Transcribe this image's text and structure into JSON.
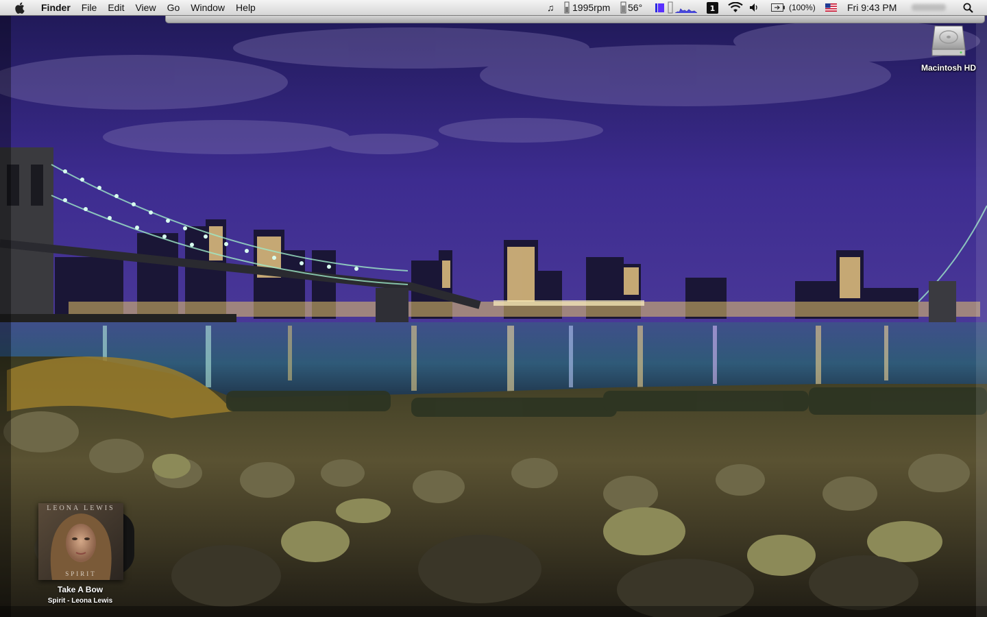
{
  "menubar": {
    "app_name": "Finder",
    "items": [
      "File",
      "Edit",
      "View",
      "Go",
      "Window",
      "Help"
    ],
    "status": {
      "fan_speed": "1995rpm",
      "temperature": "56°",
      "battery": "(100%)",
      "clock": "Fri 9:43 PM"
    }
  },
  "desktop": {
    "disk_label": "Macintosh HD"
  },
  "now_playing": {
    "track": "Take A Bow",
    "info": "Spirit - Leona Lewis",
    "album_artist_text": "LEONA LEWIS",
    "album_title_text": "SPIRIT"
  },
  "colors": {
    "sky_top": "#2a1f6e",
    "sky_bottom": "#3a2a8a",
    "bridge_lights": "#bfffd8",
    "menubar": "#e8e8e8"
  }
}
